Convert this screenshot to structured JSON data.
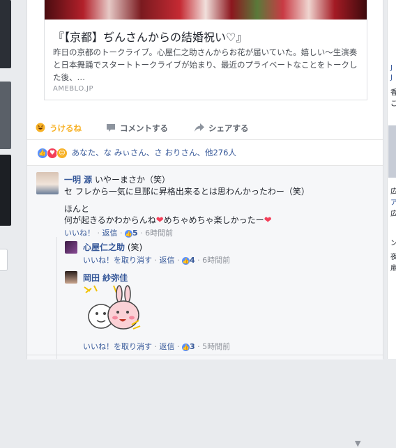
{
  "card": {
    "title": "『【京都】ぢんさんからの結婚祝い♡』",
    "description": "昨日の京都のトークライブ。心屋仁之助さんからお花が届いていた。嬉しい〜生演奏と日本舞踊でスタートトークライブが始まり、最近のプライベートなことをトークした後、…",
    "domain": "AMEBLO.JP"
  },
  "actions": {
    "like": "うけるね",
    "comment": "コメントする",
    "share": "シェアする"
  },
  "reactions_summary": "あなた、な みぃさん、さ おりさん、他276人",
  "comments": [
    {
      "author": "一明 源",
      "line1": "いやーまさか（笑）",
      "line2": "セ フレから一気に旦那に昇格出来るとは思わんかったわー（笑）",
      "line3": "ほんと",
      "line4a": "何が起きるかわからんね",
      "line4b": "めちゃめちゃ楽しかったー",
      "like": "いいね！",
      "reply": "返信",
      "likes": "5",
      "time": "6時間前"
    },
    {
      "author": "心屋仁之助",
      "text": "(笑)",
      "unlike": "いいね！を取り消す",
      "reply": "返信",
      "likes": "4",
      "time": "6時間前"
    },
    {
      "author": "岡田 紗弥佳",
      "unlike": "いいね！を取り消す",
      "reply": "返信",
      "likes": "3",
      "time": "5時間前"
    }
  ],
  "sidebar_right": [
    "J",
    "J",
    "香",
    "こ",
    "広",
    "ア",
    "広",
    "ン",
    "夜",
    "扉"
  ],
  "colors": {
    "link": "#365899",
    "haha": "#f7b125",
    "heart": "#f33e58",
    "like": "#5890ff"
  }
}
